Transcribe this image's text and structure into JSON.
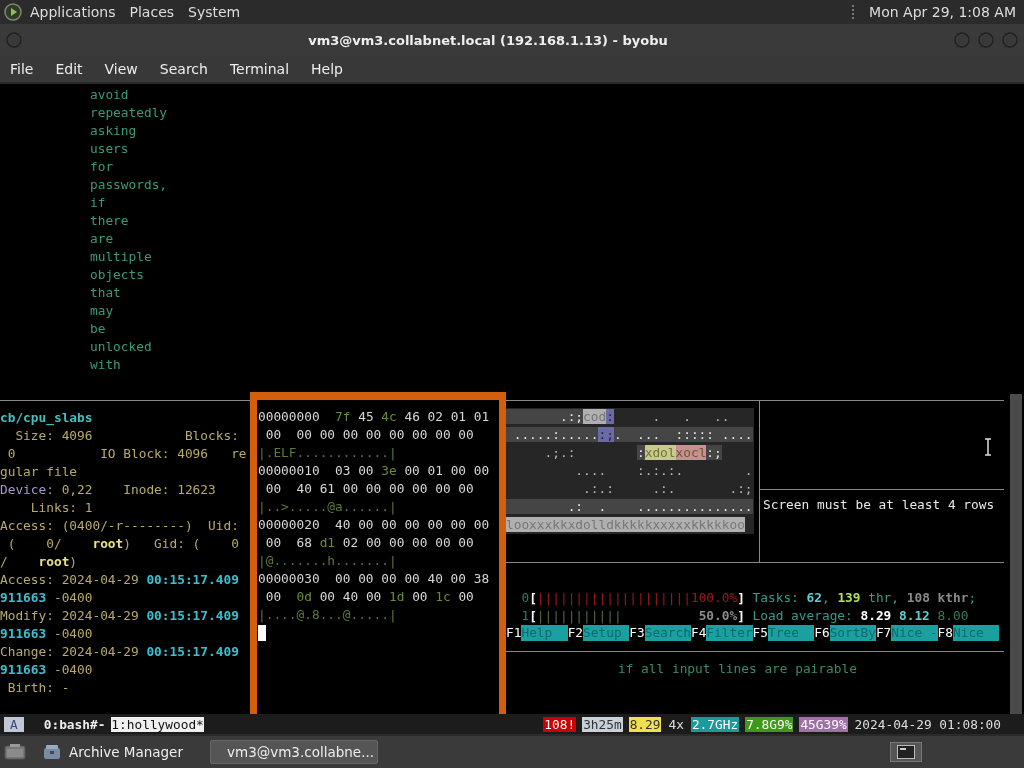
{
  "top_panel": {
    "menus": [
      "Applications",
      "Places",
      "System"
    ],
    "clock": "Mon Apr 29, 1:08 AM"
  },
  "window": {
    "title": "vm3@vm3.collabnet.local (192.168.1.13) - byobu"
  },
  "menu_bar": [
    "File",
    "Edit",
    "View",
    "Search",
    "Terminal",
    "Help"
  ],
  "terminal": {
    "top_pane": {
      "words": [
        "avoid",
        "repeatedly",
        "asking",
        "users",
        "for",
        "passwords,",
        "if",
        "there",
        "are",
        "multiple",
        "objects",
        "that",
        "may",
        "be",
        "unlocked",
        "with"
      ]
    },
    "stat_pane": {
      "lines": [
        [
          {
            "text": "cb/cpu_slabs",
            "kind": "path"
          }
        ],
        [
          {
            "text": "  Size: 4096            Blocks: ",
            "kind": "text"
          }
        ],
        [
          {
            "text": " 0           IO Block: 4096   re",
            "kind": "text"
          }
        ],
        [
          {
            "text": "gular file",
            "kind": "text"
          }
        ],
        [
          {
            "text": "Device:",
            "kind": "device"
          },
          {
            "text": " 0,22    Inode: 12623",
            "kind": "text"
          }
        ],
        [
          {
            "text": "    Links: 1",
            "kind": "text"
          }
        ],
        [
          {
            "text": "Access: (0400/-r--------)  Uid: ",
            "kind": "text"
          }
        ],
        [
          {
            "text": " (    0/    ",
            "kind": "text"
          },
          {
            "text": "root",
            "kind": "bold"
          },
          {
            "text": ")   Gid: (    0",
            "kind": "text"
          }
        ],
        [
          {
            "text": "/    ",
            "kind": "text"
          },
          {
            "text": "root",
            "kind": "bold"
          },
          {
            "text": ")",
            "kind": "text"
          }
        ],
        [
          {
            "text": "Access: 2024-04-29 ",
            "kind": "text"
          },
          {
            "text": "00:15:17.409",
            "kind": "time"
          }
        ],
        [
          {
            "text": "911663",
            "kind": "time"
          },
          {
            "text": " -0400",
            "kind": "text"
          }
        ],
        [
          {
            "text": "Modify: 2024-04-29 ",
            "kind": "text"
          },
          {
            "text": "00:15:17.409",
            "kind": "time"
          }
        ],
        [
          {
            "text": "911663",
            "kind": "time"
          },
          {
            "text": " -0400",
            "kind": "text"
          }
        ],
        [
          {
            "text": "Change: 2024-04-29 ",
            "kind": "text"
          },
          {
            "text": "00:15:17.409",
            "kind": "time"
          }
        ],
        [
          {
            "text": "911663",
            "kind": "time"
          },
          {
            "text": " -0400",
            "kind": "text"
          }
        ],
        [
          {
            "text": " Birth: -",
            "kind": "text"
          }
        ]
      ]
    },
    "hex_pane": {
      "lines": [
        [
          {
            "text": "00000000  ",
            "kind": "hex"
          },
          {
            "text": "7f",
            "kind": "hi"
          },
          {
            "text": " 45 ",
            "kind": "hex"
          },
          {
            "text": "4c",
            "kind": "hi"
          },
          {
            "text": " 46 02 01 01",
            "kind": "hex"
          }
        ],
        [
          {
            "text": " 00  00 00 00 00 00 00 00 00",
            "kind": "hex"
          }
        ],
        [
          {
            "text": "|.ELF............|",
            "kind": "ascii"
          }
        ],
        [
          {
            "text": "00000010  03 00 ",
            "kind": "hex"
          },
          {
            "text": "3e",
            "kind": "hi"
          },
          {
            "text": " 00 01 00 00",
            "kind": "hex"
          }
        ],
        [
          {
            "text": " 00  40 61 00 00 00 00 00 00",
            "kind": "hex"
          }
        ],
        [
          {
            "text": "|..>.....@a......|",
            "kind": "ascii"
          }
        ],
        [
          {
            "text": "00000020  40 00 00 00 00 00 00",
            "kind": "hex"
          }
        ],
        [
          {
            "text": " 00  68 ",
            "kind": "hex"
          },
          {
            "text": "d1",
            "kind": "hi"
          },
          {
            "text": " 02 00 00 00 00 00",
            "kind": "hex"
          }
        ],
        [
          {
            "text": "|@.......h.......|",
            "kind": "ascii"
          }
        ],
        [
          {
            "text": "00000030  00 00 00 00 40 00 38",
            "kind": "hex"
          }
        ],
        [
          {
            "text": " 00  ",
            "kind": "hex"
          },
          {
            "text": "0d",
            "kind": "hi"
          },
          {
            "text": " 00 40 00 ",
            "kind": "hex"
          },
          {
            "text": "1d",
            "kind": "hi"
          },
          {
            "text": " 00 ",
            "kind": "hex"
          },
          {
            "text": "1c",
            "kind": "hi"
          },
          {
            "text": " 00",
            "kind": "hex"
          }
        ],
        [
          {
            "text": "|....@.8...@.....|",
            "kind": "ascii"
          }
        ]
      ]
    },
    "art_pane": {
      "lines": [
        [
          {
            "text": "       .:;",
            "kind": "mid"
          },
          {
            "text": "cod",
            "kind": "light"
          },
          {
            "text": ":",
            "kind": "blue"
          },
          {
            "text": "     .   .   ..",
            "kind": "dark"
          }
        ],
        [
          {
            "text": " .....:.....",
            "kind": "mid"
          },
          {
            "text": ":;",
            "kind": "blue"
          },
          {
            "text": ".  ...  ::::: ....",
            "kind": "mid"
          }
        ],
        [
          {
            "text": "     .;.:        ",
            "kind": "dark"
          },
          {
            "text": ":",
            "kind": "mid"
          },
          {
            "text": "xdol",
            "kind": "yellow"
          },
          {
            "text": "xocl",
            "kind": "pink"
          },
          {
            "text": ":;",
            "kind": "mid"
          }
        ],
        [
          {
            "text": "         ....    :.:.:.        .",
            "kind": "dark"
          }
        ],
        [
          {
            "text": "          .:.:     .:.       .:;",
            "kind": "dark"
          }
        ],
        [
          {
            "text": "        .:  .    ...............",
            "kind": "mid"
          }
        ],
        [
          {
            "text": "looxxxkkxdolldkkkkkxxxxxkkkkkoo",
            "kind": "light"
          }
        ]
      ]
    },
    "message_pane": {
      "text": "Screen must be at least 4 rows"
    },
    "htop": {
      "lines": [
        [
          {
            "text": "  0",
            "kind": "dim"
          },
          {
            "text": "[",
            "kind": "white"
          },
          {
            "text": "||||||||||||||||||||100.0%",
            "kind": "red"
          },
          {
            "text": "]",
            "kind": "white"
          },
          {
            "text": " Tasks: ",
            "kind": "teal"
          },
          {
            "text": "62",
            "kind": "cyan"
          },
          {
            "text": ", ",
            "kind": "teal"
          },
          {
            "text": "139",
            "kind": "green"
          },
          {
            "text": " thr, ",
            "kind": "teal"
          },
          {
            "text": "108 kthr",
            "kind": "grey"
          },
          {
            "text": ";",
            "kind": "teal"
          }
        ],
        [
          {
            "text": "  1",
            "kind": "dim"
          },
          {
            "text": "[",
            "kind": "white"
          },
          {
            "text": "|||||||||||",
            "kind": "olive"
          },
          {
            "text": "          50.0%",
            "kind": "grey"
          },
          {
            "text": "]",
            "kind": "white"
          },
          {
            "text": " Load average: ",
            "kind": "teal"
          },
          {
            "text": "8.29",
            "kind": "white"
          },
          {
            "text": " 8.12",
            "kind": "cyan"
          },
          {
            "text": " 8.00",
            "kind": "dim"
          }
        ]
      ],
      "function_keys": [
        {
          "key": "F1",
          "label": "Help"
        },
        {
          "key": "F2",
          "label": "Setup"
        },
        {
          "key": "F3",
          "label": "Search"
        },
        {
          "key": "F4",
          "label": "Filter"
        },
        {
          "key": "F5",
          "label": "Tree"
        },
        {
          "key": "F6",
          "label": "SortBy"
        },
        {
          "key": "F7",
          "label": "Nice -"
        },
        {
          "key": "F8",
          "label": "Nice"
        }
      ]
    },
    "bottom_pane": {
      "text": "if all input lines are pairable"
    }
  },
  "status_bar": {
    "session": "A",
    "windows": [
      {
        "label": "0:bash#-",
        "selected": false
      },
      {
        "label": "1:hollywood*",
        "selected": true
      }
    ],
    "indicators": [
      {
        "text": "108!",
        "color": "#cc0000"
      },
      {
        "text": "3h25m",
        "color": "#c8d0d8"
      },
      {
        "text": "8.29",
        "color": "#f0e050"
      },
      {
        "text": "4x"
      },
      {
        "text": "2.7GHz",
        "color": "#1a9a9a"
      },
      {
        "text": "7.8G9%",
        "color": "#3c9a18"
      },
      {
        "text": "45G39%",
        "color": "#a070a8"
      },
      {
        "text": "2024-04-29 01:08:00"
      }
    ]
  },
  "taskbar": {
    "tasks": [
      {
        "label": "Archive Manager",
        "kind": "archive",
        "selected": false
      },
      {
        "label": "vm3@vm3.collabne...",
        "kind": "terminal",
        "selected": true
      }
    ]
  }
}
